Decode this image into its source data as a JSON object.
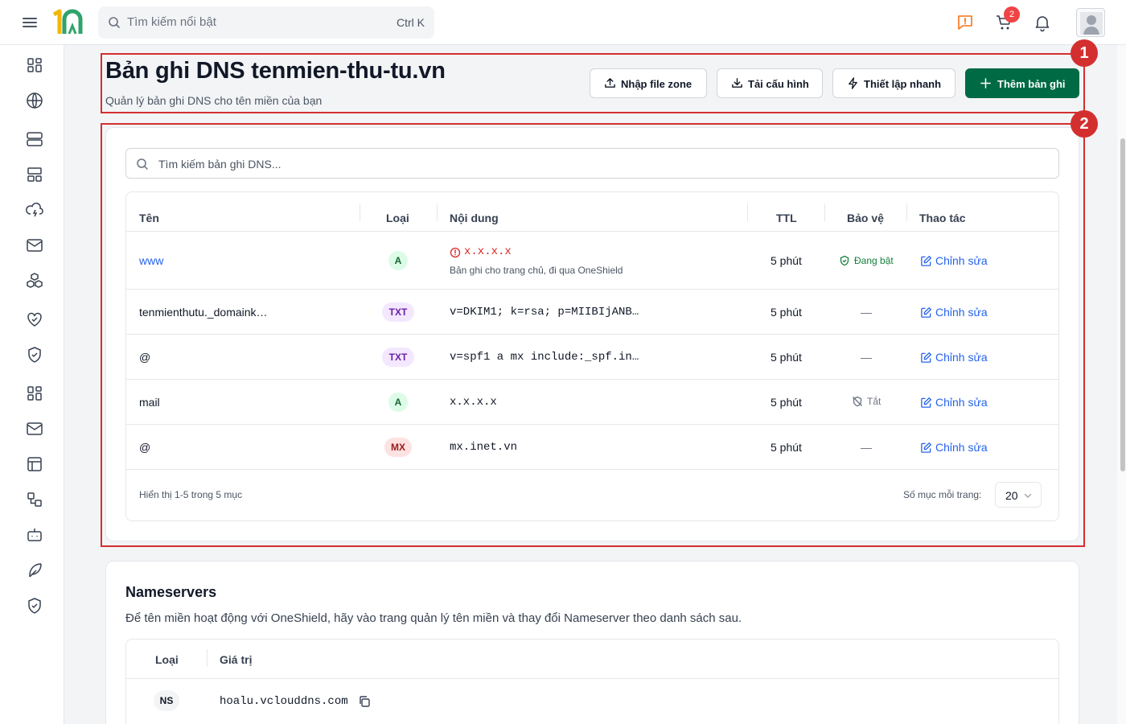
{
  "topbar": {
    "search_placeholder": "Tìm kiếm nổi bật",
    "search_shortcut": "Ctrl K",
    "cart_count": "2"
  },
  "page": {
    "title": "Bản ghi DNS tenmien-thu-tu.vn",
    "subtitle": "Quản lý bản ghi DNS cho tên miền của bạn"
  },
  "actions": {
    "import_zone": "Nhập file zone",
    "download_config": "Tải cấu hình",
    "quick_setup": "Thiết lập nhanh",
    "add_record": "Thêm bản ghi"
  },
  "dns": {
    "search_placeholder": "Tìm kiếm bản ghi DNS...",
    "columns": {
      "name": "Tên",
      "type": "Loại",
      "content": "Nội dung",
      "ttl": "TTL",
      "protection": "Bảo vệ",
      "actions": "Thao tác"
    },
    "rows": [
      {
        "name": "www",
        "type": "A",
        "content": "x.x.x.x",
        "note": "Bản ghi cho trang chủ, đi qua OneShield",
        "ttl": "5 phút",
        "protection": "Đang bật",
        "action": "Chỉnh sửa"
      },
      {
        "name": "tenmienthutu._domaink…",
        "type": "TXT",
        "content": "v=DKIM1; k=rsa; p=MIIBIjANB…",
        "ttl": "5 phút",
        "protection": "—",
        "action": "Chỉnh sửa"
      },
      {
        "name": "@",
        "type": "TXT",
        "content": "v=spf1 a mx include:_spf.in…",
        "ttl": "5 phút",
        "protection": "—",
        "action": "Chỉnh sửa"
      },
      {
        "name": "mail",
        "type": "A",
        "content": "x.x.x.x",
        "ttl": "5 phút",
        "protection": "Tắt",
        "action": "Chỉnh sửa"
      },
      {
        "name": "@",
        "type": "MX",
        "content": "mx.inet.vn",
        "ttl": "5 phút",
        "protection": "—",
        "action": "Chỉnh sửa"
      }
    ],
    "footer_summary": "Hiển thị 1-5 trong 5 mục",
    "page_size_label": "Số mục mỗi trang:",
    "page_size_value": "20"
  },
  "annotations": [
    "1",
    "2"
  ],
  "nameservers": {
    "title": "Nameservers",
    "description": "Để tên miền hoạt động với OneShield, hãy vào trang quản lý tên miền và thay đổi Nameserver theo danh sách sau.",
    "columns": {
      "type": "Loại",
      "value": "Giá trị"
    },
    "rows": [
      {
        "type": "NS",
        "value": "hoalu.vclouddns.com"
      }
    ]
  },
  "colors": {
    "primary": "#006a45",
    "link": "#2563eb",
    "annotation": "#d32f2f",
    "badge_a": "#dcfce7",
    "badge_txt": "#f3e8ff",
    "badge_mx": "#fee2e2"
  },
  "icons": {
    "sidebar": [
      "dashboard-icon",
      "globe-icon",
      "server-icon",
      "layout-icon",
      "cloud-lightning-icon",
      "mail-icon",
      "boxes-icon",
      "heart-handshake-icon",
      "shield-check-icon",
      "dashboard-icon",
      "mail-icon",
      "panel-icon",
      "workflow-icon",
      "bot-icon",
      "feather-icon",
      "shield-check-icon"
    ]
  }
}
